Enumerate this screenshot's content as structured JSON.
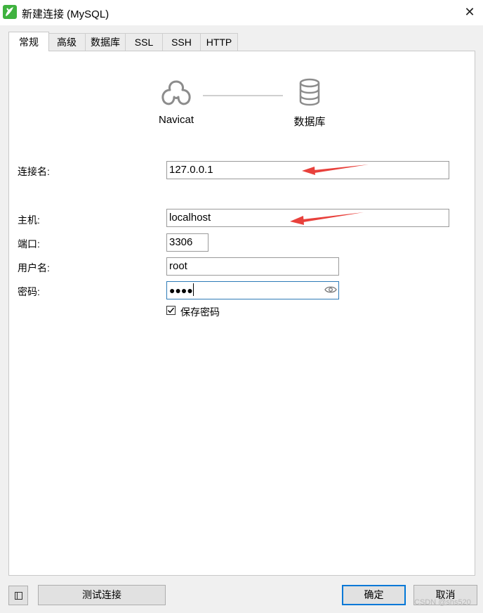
{
  "window": {
    "title": "新建连接 (MySQL)",
    "close_glyph": "✕"
  },
  "tabs": [
    {
      "label": "常规",
      "active": true
    },
    {
      "label": "高级",
      "active": false
    },
    {
      "label": "数据库",
      "active": false
    },
    {
      "label": "SSL",
      "active": false
    },
    {
      "label": "SSH",
      "active": false
    },
    {
      "label": "HTTP",
      "active": false
    }
  ],
  "diagram": {
    "left_node": {
      "label": "Navicat",
      "icon": "navicat-logo-icon"
    },
    "right_node": {
      "label": "数据库",
      "icon": "database-icon"
    }
  },
  "form": {
    "connection_name": {
      "label": "连接名:",
      "value": "127.0.0.1"
    },
    "host": {
      "label": "主机:",
      "value": "localhost"
    },
    "port": {
      "label": "端口:",
      "value": "3306"
    },
    "username": {
      "label": "用户名:",
      "value": "root"
    },
    "password": {
      "label": "密码:",
      "value": "●●●●",
      "icon": "eye-icon"
    },
    "save_password": {
      "label": "保存密码",
      "checked": true
    }
  },
  "buttons": {
    "test_connection": "测试连接",
    "ok": "确定",
    "cancel": "取消"
  },
  "watermark": "CSDN @shs520",
  "colors": {
    "annotation_arrow": "#e8413c",
    "focus_border": "#2e7bb7",
    "app_icon": "#3fb23f"
  }
}
